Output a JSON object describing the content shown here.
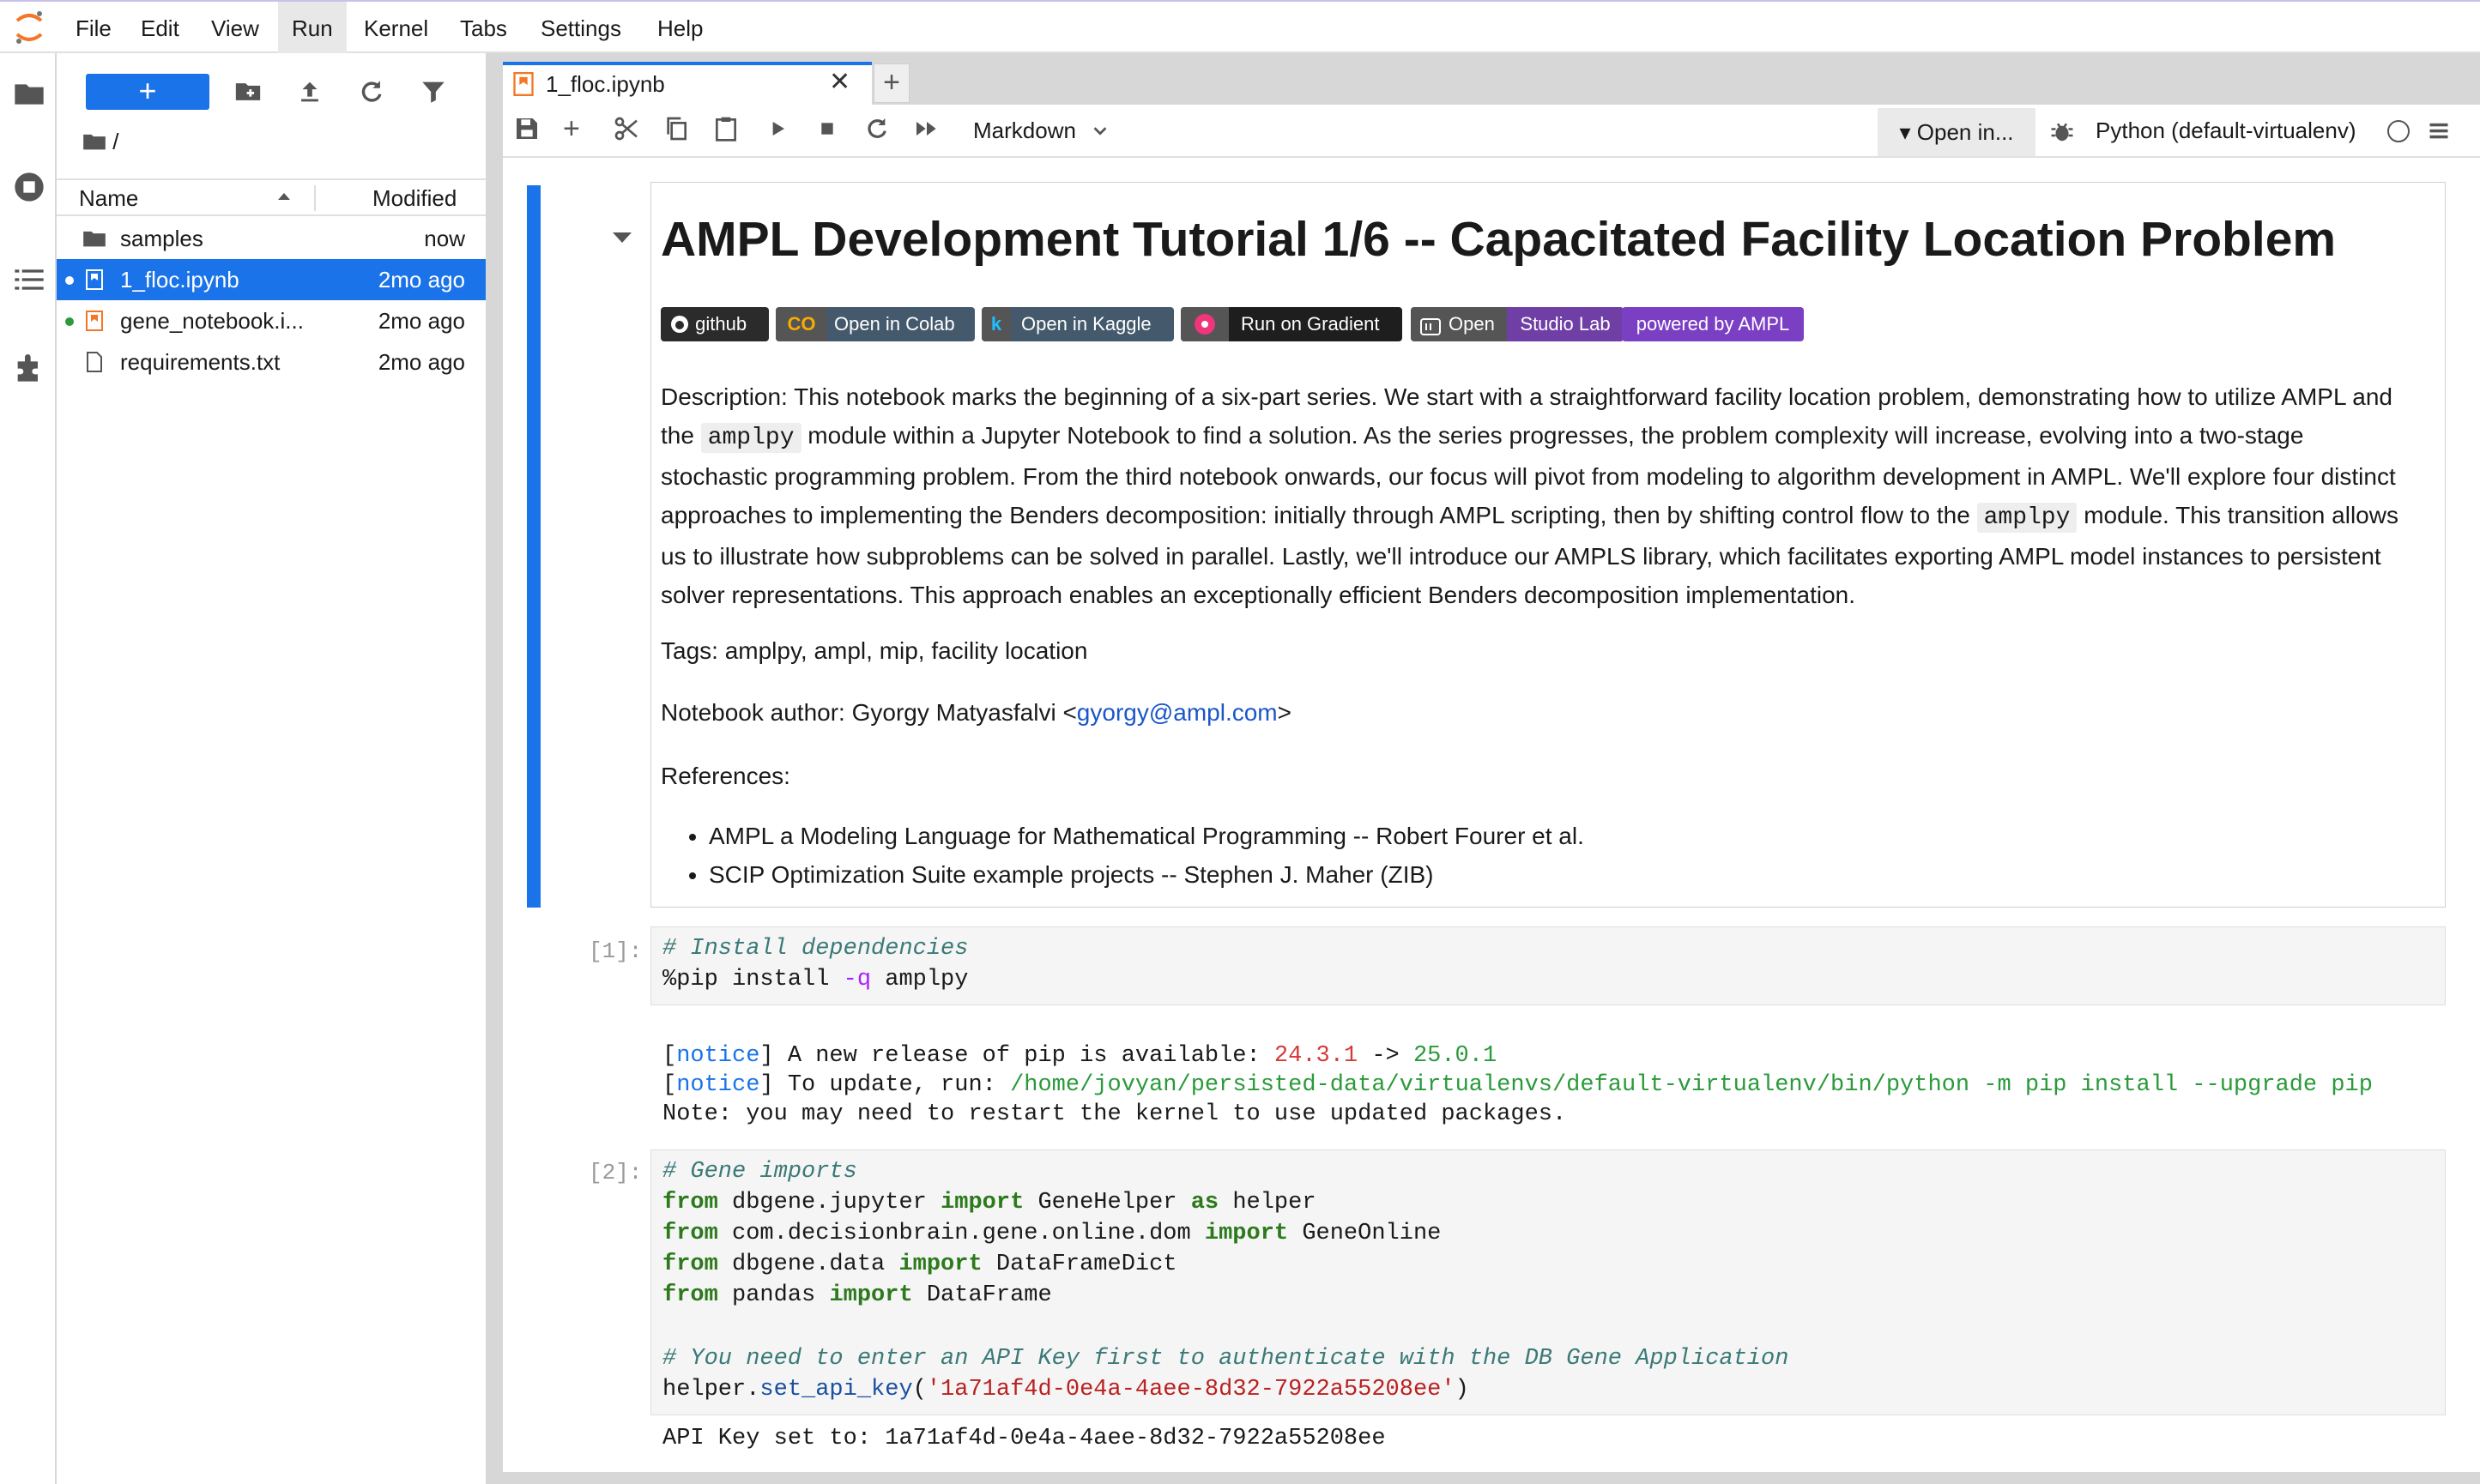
{
  "menubar": {
    "items": [
      "File",
      "Edit",
      "View",
      "Run",
      "Kernel",
      "Tabs",
      "Settings",
      "Help"
    ],
    "active": "Run"
  },
  "filebrowser": {
    "breadcrumb": "/",
    "header": {
      "name": "Name",
      "modified": "Modified"
    },
    "files": [
      {
        "name": "samples",
        "modified": "now",
        "type": "folder"
      },
      {
        "name": "1_floc.ipynb",
        "modified": "2mo ago",
        "type": "notebook",
        "selected": true
      },
      {
        "name": "gene_notebook.i...",
        "modified": "2mo ago",
        "type": "notebook"
      },
      {
        "name": "requirements.txt",
        "modified": "2mo ago",
        "type": "file"
      }
    ]
  },
  "tabs": [
    {
      "label": "1_floc.ipynb"
    }
  ],
  "toolbar": {
    "cell_type": "Markdown",
    "open_in": "Open in...",
    "kernel": "Python (default-virtualenv)"
  },
  "markdown_cell": {
    "title": "AMPL Development Tutorial 1/6 -- Capacitated Facility Location Problem",
    "badges": [
      "github",
      "Open in Colab",
      "Open in Kaggle",
      "Run on Gradient",
      "Open",
      "Studio Lab",
      "powered by AMPL"
    ],
    "description_parts": [
      "Description: This notebook marks the beginning of a six-part series. We start with a straightforward facility location problem, demonstrating how to utilize AMPL and the ",
      "amplpy",
      " module within a Jupyter Notebook to find a solution. As the series progresses, the problem complexity will increase, evolving into a two-stage stochastic programming problem. From the third notebook onwards, our focus will pivot from modeling to algorithm development in AMPL. We'll explore four distinct approaches to implementing the Benders decomposition: initially through AMPL scripting, then by shifting control flow to the ",
      "amplpy",
      " module. This transition allows us to illustrate how subproblems can be solved in parallel. Lastly, we'll introduce our AMPLS library, which facilitates exporting AMPL model instances to persistent solver representations. This approach enables an exceptionally efficient Benders decomposition implementation."
    ],
    "tags": "Tags: amplpy, ampl, mip, facility location",
    "author_prefix": "Notebook author: Gyorgy Matyasfalvi <",
    "author_email": "gyorgy@ampl.com",
    "author_suffix": ">",
    "references_label": "References:",
    "references": [
      "AMPL a Modeling Language for Mathematical Programming -- Robert Fourer et al.",
      "SCIP Optimization Suite example projects -- Stephen J. Maher (ZIB)"
    ]
  },
  "cell1": {
    "prompt": "[1]:",
    "comment": "# Install dependencies",
    "cmd_a": "%pip install ",
    "cmd_b": "-q",
    "cmd_c": " amplpy",
    "out1_a": "[",
    "out1_b": "notice",
    "out1_c": "] A new release of pip is available: ",
    "out1_d": "24.3.1",
    "out1_e": " -> ",
    "out1_f": "25.0.1",
    "out2_a": "[",
    "out2_b": "notice",
    "out2_c": "] To update, run: ",
    "out2_d": "/home/jovyan/persisted-data/virtualenvs/default-virtualenv/bin/python -m pip install --upgrade pip",
    "out3": "Note: you may need to restart the kernel to use updated packages."
  },
  "cell2": {
    "prompt": "[2]:",
    "comment1": "# Gene imports",
    "l1_mod": " dbgene.jupyter ",
    "l1_name": " GeneHelper ",
    "l1_alias": " helper",
    "l2_mod": " com.decisionbrain.gene.online.dom ",
    "l2_name": " GeneOnline",
    "l3_mod": " dbgene.data ",
    "l3_name": " DataFrameDict",
    "l4_mod": " pandas ",
    "l4_name": " DataFrame",
    "kw_from": "from",
    "kw_import": "import",
    "kw_as": "as",
    "comment2": "# You need to enter an API Key first to authenticate with the DB Gene Application",
    "call_obj": "helper.",
    "call_fn": "set_api_key",
    "call_open": "(",
    "call_str": "'1a71af4d-0e4a-4aee-8d32-7922a55208ee'",
    "call_close": ")",
    "output": "API Key set to: 1a71af4d-0e4a-4aee-8d32-7922a55208ee"
  },
  "colors": {
    "accent": "#1a73e8",
    "badge_purple": "#7b3fc4"
  }
}
